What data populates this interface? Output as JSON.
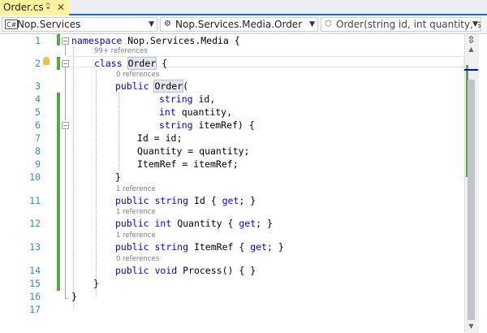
{
  "tab": {
    "title": "Order.cs",
    "pin_glyph": "⮸",
    "close_glyph": "✕"
  },
  "nav": {
    "project": {
      "icon_text": "C#",
      "label": "Nop.Services"
    },
    "type": {
      "label": "Nop.Services.Media.Order"
    },
    "member": {
      "label": "Order(string id, int quantity, st"
    }
  },
  "editor": {
    "lines": [
      {
        "no": "1"
      },
      {
        "no": "2"
      },
      {
        "no": "3"
      },
      {
        "no": "4"
      },
      {
        "no": "5"
      },
      {
        "no": "6"
      },
      {
        "no": "7"
      },
      {
        "no": "8"
      },
      {
        "no": "9"
      },
      {
        "no": "10"
      },
      {
        "no": "11"
      },
      {
        "no": "12"
      },
      {
        "no": "13"
      },
      {
        "no": "14"
      },
      {
        "no": "15"
      },
      {
        "no": "16"
      },
      {
        "no": "17"
      }
    ],
    "code": {
      "l1": {
        "kw": "namespace",
        "rest": " Nop.Services.Media {"
      },
      "l2": {
        "kw": "class",
        "name": "Order",
        "rest": " {"
      },
      "l3": {
        "kw": "public",
        "name": "Order",
        "rest": "("
      },
      "l4": {
        "kw": "string",
        "rest": " id,"
      },
      "l5": {
        "kw": "int",
        "rest": " quantity,"
      },
      "l6": {
        "kw": "string",
        "rest": " itemRef) {"
      },
      "l7": {
        "text": "Id = id;"
      },
      "l8": {
        "text": "Quantity = quantity;"
      },
      "l9": {
        "text": "ItemRef = itemRef;"
      },
      "l10": {
        "text": "}"
      },
      "l11": {
        "kw1": "public",
        "kw2": "string",
        "mid": " Id { ",
        "kw3": "get",
        "rest": "; }"
      },
      "l12": {
        "kw1": "public",
        "kw2": "int",
        "mid": " Quantity { ",
        "kw3": "get",
        "rest": "; }"
      },
      "l13": {
        "kw1": "public",
        "kw2": "string",
        "mid": " ItemRef { ",
        "kw3": "get",
        "rest": "; }"
      },
      "l14": {
        "kw1": "public",
        "kw2": "void",
        "rest": " Process() { }"
      },
      "l15": {
        "text": "}"
      },
      "l16": {
        "text": "}"
      }
    },
    "codelens": {
      "class_refs": "99+ references",
      "ctor_refs": "0 references",
      "id_refs": "1 reference",
      "quantity_refs": "1 reference",
      "itemref_refs": "1 reference",
      "process_refs": "0 references"
    },
    "fold_minus": "−"
  },
  "colors": {
    "keyword": "#0000ff",
    "line_number": "#2b91af",
    "change_bar": "#57a64a",
    "accent": "#007acc",
    "tab_active": "#fff29d"
  },
  "icons": {
    "splitter": "split-icon",
    "lightbulb": "lightbulb-icon",
    "member": "method-icon"
  }
}
